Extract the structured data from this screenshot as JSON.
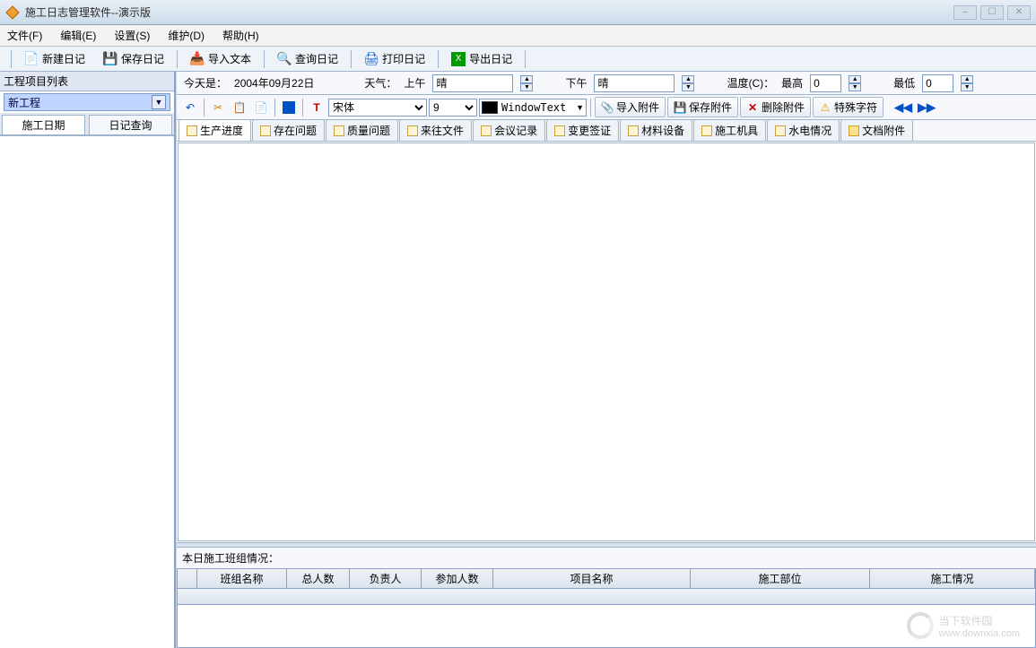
{
  "title": "施工日志管理软件--演示版",
  "menu": {
    "file": "文件(F)",
    "edit": "编辑(E)",
    "settings": "设置(S)",
    "maintain": "维护(D)",
    "help": "帮助(H)"
  },
  "toolbar1": {
    "new": "新建日记",
    "save": "保存日记",
    "import": "导入文本",
    "query": "查询日记",
    "print": "打印日记",
    "export": "导出日记"
  },
  "left": {
    "list_header": "工程项目列表",
    "project": "新工程",
    "tab_date": "施工日期",
    "tab_query": "日记查询"
  },
  "info": {
    "today_label": "今天是：",
    "today_value": "2004年09月22日",
    "weather_label": "天气：",
    "am_label": "上午",
    "am_value": "晴",
    "pm_label": "下午",
    "pm_value": "晴",
    "temp_label": "温度(C)：",
    "max_label": "最高",
    "max_value": "0",
    "min_label": "最低",
    "min_value": "0"
  },
  "toolbar2": {
    "font": "宋体",
    "size": "9",
    "color": "WindowText",
    "import_attach": "导入附件",
    "save_attach": "保存附件",
    "delete_attach": "删除附件",
    "special_char": "特殊字符"
  },
  "tabs": [
    "生产进度",
    "存在问题",
    "质量问题",
    "来往文件",
    "会议记录",
    "变更签证",
    "材料设备",
    "施工机具",
    "水电情况",
    "文档附件"
  ],
  "team": {
    "header": "本日施工班组情况：",
    "cols": [
      "班组名称",
      "总人数",
      "负责人",
      "参加人数",
      "项目名称",
      "施工部位",
      "施工情况"
    ]
  },
  "watermark": {
    "main": "当下软件园",
    "sub": "www.downxia.com"
  }
}
